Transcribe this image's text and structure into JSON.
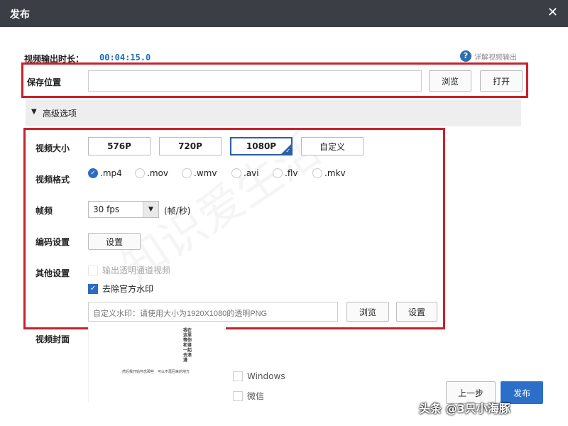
{
  "window": {
    "title": "发布",
    "close_glyph": "✕"
  },
  "export": {
    "duration_label": "视频输出时长：",
    "duration_value": "00:04:15.0"
  },
  "help": {
    "icon_text": "?",
    "label": "详解视频输出"
  },
  "save": {
    "label": "保存位置",
    "path_value": "",
    "browse_label": "浏览",
    "open_label": "打开"
  },
  "advanced": {
    "arrow": "▼",
    "label": "高级选项"
  },
  "size": {
    "label": "视频大小",
    "options": [
      "576P",
      "720P",
      "1080P",
      "自定义"
    ],
    "selected": "1080P"
  },
  "format": {
    "label": "视频格式",
    "options": [
      ".mp4",
      ".mov",
      ".wmv",
      ".avi",
      ".flv",
      ".mkv"
    ],
    "selected": ".mp4"
  },
  "fps": {
    "label": "帧频",
    "value": "30 fps",
    "unit": "(帧/秒)"
  },
  "encoding": {
    "label": "编码设置",
    "settings_label": "设置"
  },
  "other": {
    "label": "其他设置",
    "alpha_label": "输出透明通道视频",
    "alpha_checked": false,
    "remove_wm_label": "去除官方水印",
    "remove_wm_checked": true,
    "custom_wm_placeholder": "自定义水印：请使用大小为1920X1080的透明PNG",
    "browse_label": "浏览",
    "settings_label": "设置"
  },
  "cover": {
    "label": "视频封面",
    "vertical_text": "我在这里等你和谁一起去浪漫",
    "line1": "然后我开始怀念那些",
    "line2": "可以不再回来的地方"
  },
  "share": {
    "windows_label": "Windows",
    "wechat_label": "微信"
  },
  "footer": {
    "prev_label": "上一步",
    "publish_label": "发布",
    "watermark": "头条 @3只小海豚"
  },
  "background_watermark": "知识爱生活",
  "colors": {
    "titlebar": "#3b3f45",
    "highlight_border": "#c8202c",
    "accent": "#2c6fc8",
    "duration": "#1f6fb5"
  }
}
